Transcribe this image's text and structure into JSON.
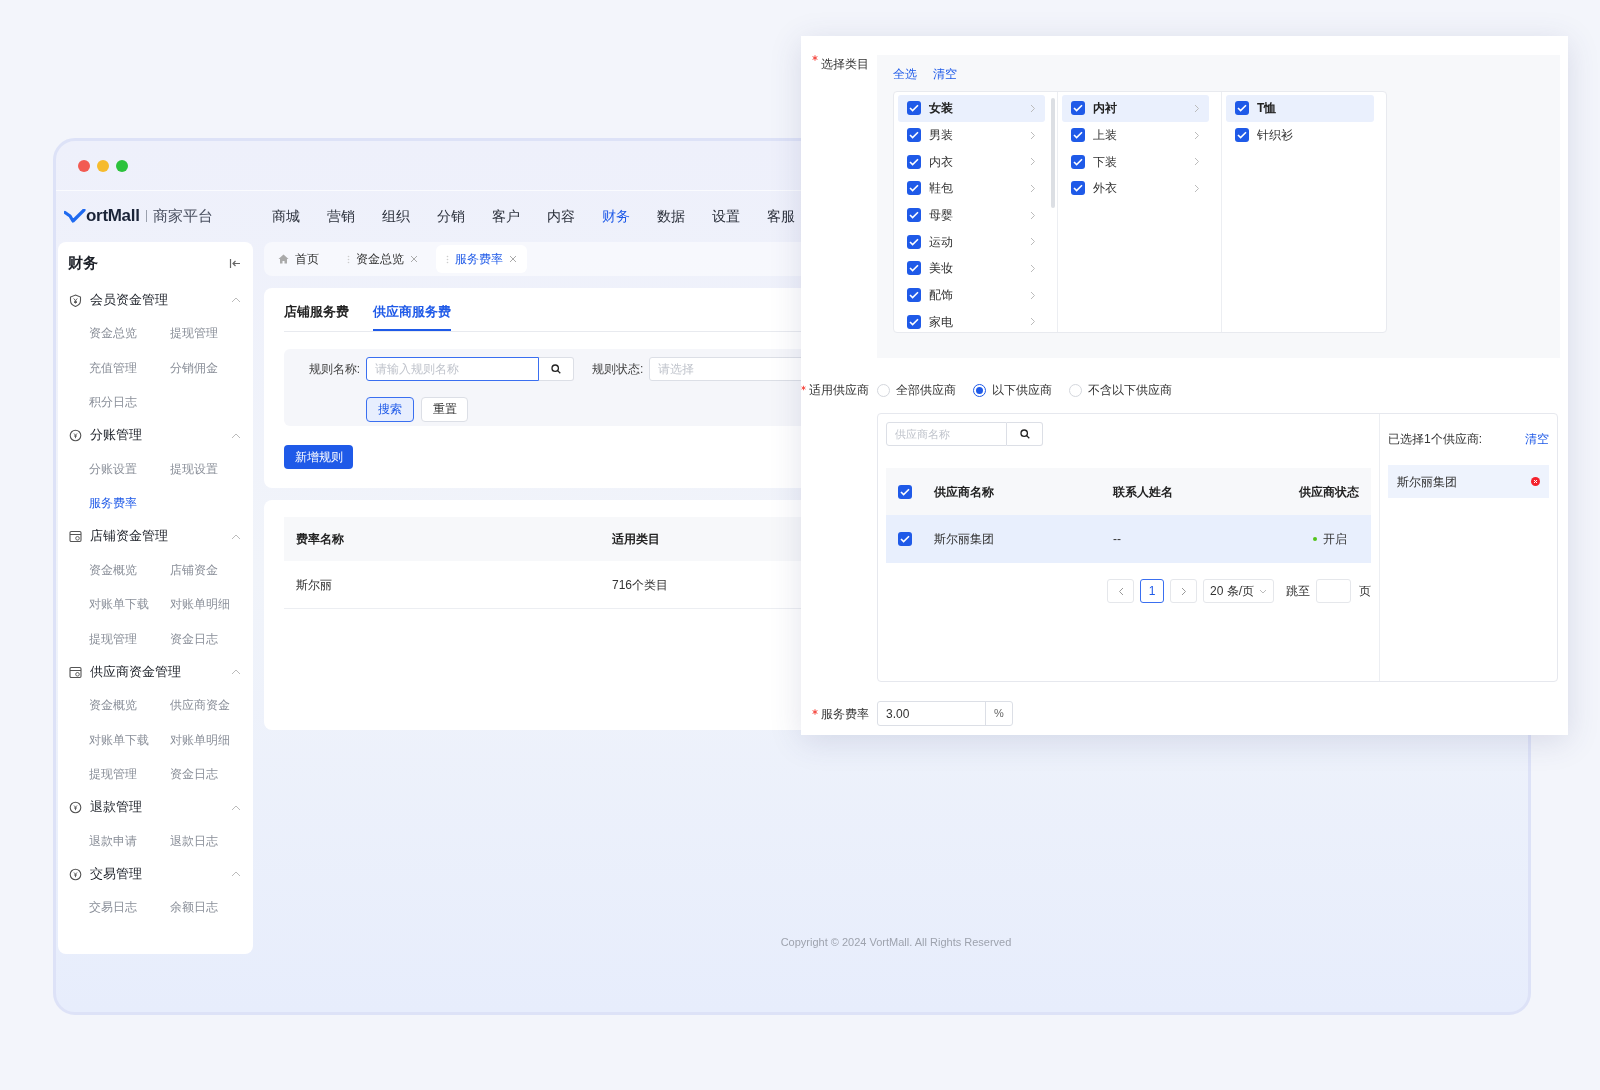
{
  "brand": {
    "logo": "ortMall",
    "subtitle": "商家平台"
  },
  "nav": [
    {
      "label": "商城",
      "selected": false
    },
    {
      "label": "营销",
      "selected": false
    },
    {
      "label": "组织",
      "selected": false
    },
    {
      "label": "分销",
      "selected": false
    },
    {
      "label": "客户",
      "selected": false
    },
    {
      "label": "内容",
      "selected": false
    },
    {
      "label": "财务",
      "selected": true
    },
    {
      "label": "数据",
      "selected": false
    },
    {
      "label": "设置",
      "selected": false
    },
    {
      "label": "客服",
      "selected": false
    }
  ],
  "sidebar": {
    "title": "财务",
    "groups": [
      {
        "title": "会员资金管理",
        "expanded": true,
        "items": [
          {
            "label": "资金总览",
            "selected": false
          },
          {
            "label": "提现管理",
            "selected": false
          },
          {
            "label": "充值管理",
            "selected": false
          },
          {
            "label": "分销佣金",
            "selected": false
          },
          {
            "label": "积分日志",
            "selected": false
          }
        ]
      },
      {
        "title": "分账管理",
        "expanded": true,
        "items": [
          {
            "label": "分账设置",
            "selected": false
          },
          {
            "label": "提现设置",
            "selected": false
          },
          {
            "label": "服务费率",
            "selected": true
          }
        ]
      },
      {
        "title": "店铺资金管理",
        "expanded": true,
        "items": [
          {
            "label": "资金概览",
            "selected": false
          },
          {
            "label": "店铺资金",
            "selected": false
          },
          {
            "label": "对账单下载",
            "selected": false
          },
          {
            "label": "对账单明细",
            "selected": false
          },
          {
            "label": "提现管理",
            "selected": false
          },
          {
            "label": "资金日志",
            "selected": false
          }
        ]
      },
      {
        "title": "供应商资金管理",
        "expanded": true,
        "items": [
          {
            "label": "资金概览",
            "selected": false
          },
          {
            "label": "供应商资金",
            "selected": false
          },
          {
            "label": "对账单下载",
            "selected": false
          },
          {
            "label": "对账单明细",
            "selected": false
          },
          {
            "label": "提现管理",
            "selected": false
          },
          {
            "label": "资金日志",
            "selected": false
          }
        ]
      },
      {
        "title": "退款管理",
        "expanded": true,
        "items": [
          {
            "label": "退款申请",
            "selected": false
          },
          {
            "label": "退款日志",
            "selected": false
          }
        ]
      },
      {
        "title": "交易管理",
        "expanded": true,
        "items": [
          {
            "label": "交易日志",
            "selected": false
          },
          {
            "label": "余额日志",
            "selected": false
          }
        ]
      }
    ]
  },
  "tabs": [
    {
      "label": "首页",
      "kind": "home",
      "selected": false
    },
    {
      "label": "资金总览",
      "kind": "page",
      "selected": false
    },
    {
      "label": "服务费率",
      "kind": "page",
      "selected": true
    }
  ],
  "subtabs": [
    {
      "label": "店铺服务费",
      "selected": false
    },
    {
      "label": "供应商服务费",
      "selected": true
    }
  ],
  "filters": {
    "rule_name": {
      "label": "规则名称:",
      "placeholder": "请输入规则名称",
      "focused": true
    },
    "rule_status": {
      "label": "规则状态:",
      "placeholder": "请选择"
    }
  },
  "buttons": {
    "search": "搜索",
    "reset": "重置",
    "add": "新增规则"
  },
  "table": {
    "columns": [
      "费率名称",
      "适用类目"
    ],
    "rows": [
      [
        "斯尔丽",
        "716个类目"
      ]
    ]
  },
  "footer": "Copyright © 2024 VortMall. All Rights Reserved",
  "dialog": {
    "category": {
      "label": "选择类目",
      "required": true,
      "actions": [
        "全选",
        "清空"
      ],
      "columns": [
        [
          {
            "label": "女装",
            "checked": true,
            "selected": true,
            "has_children": true
          },
          {
            "label": "男装",
            "checked": true,
            "selected": false,
            "has_children": true
          },
          {
            "label": "内衣",
            "checked": true,
            "selected": false,
            "has_children": true
          },
          {
            "label": "鞋包",
            "checked": true,
            "selected": false,
            "has_children": true
          },
          {
            "label": "母婴",
            "checked": true,
            "selected": false,
            "has_children": true
          },
          {
            "label": "运动",
            "checked": true,
            "selected": false,
            "has_children": true
          },
          {
            "label": "美妆",
            "checked": true,
            "selected": false,
            "has_children": true
          },
          {
            "label": "配饰",
            "checked": true,
            "selected": false,
            "has_children": true
          },
          {
            "label": "家电",
            "checked": true,
            "selected": false,
            "has_children": true
          }
        ],
        [
          {
            "label": "内衬",
            "checked": true,
            "selected": true,
            "has_children": true
          },
          {
            "label": "上装",
            "checked": true,
            "selected": false,
            "has_children": true
          },
          {
            "label": "下装",
            "checked": true,
            "selected": false,
            "has_children": true
          },
          {
            "label": "外衣",
            "checked": true,
            "selected": false,
            "has_children": true
          }
        ],
        [
          {
            "label": "T恤",
            "checked": true,
            "selected": true,
            "has_children": false
          },
          {
            "label": "针织衫",
            "checked": true,
            "selected": false,
            "has_children": false
          }
        ]
      ]
    },
    "supplier": {
      "label": "适用供应商",
      "required": true,
      "options": [
        {
          "label": "全部供应商",
          "selected": false
        },
        {
          "label": "以下供应商",
          "selected": true
        },
        {
          "label": "不含以下供应商",
          "selected": false
        }
      ],
      "search_placeholder": "供应商名称",
      "columns": [
        "供应商名称",
        "联系人姓名",
        "供应商状态"
      ],
      "all_checked": true,
      "rows": [
        {
          "name": "斯尔丽集团",
          "contact": "--",
          "status": "开启",
          "color": "#52c41a",
          "checked": true
        }
      ],
      "pagination": {
        "pages": [
          {
            "label": "1",
            "selected": true
          }
        ],
        "page_size": "20 条/页",
        "jump_label": "跳至",
        "page_unit": "页"
      },
      "selected_title": "已选择1个供应商:",
      "clear": "清空",
      "selected_items": [
        "斯尔丽集团"
      ]
    },
    "fee": {
      "label": "服务费率",
      "required": true,
      "value": "3.00",
      "unit": "%"
    }
  }
}
